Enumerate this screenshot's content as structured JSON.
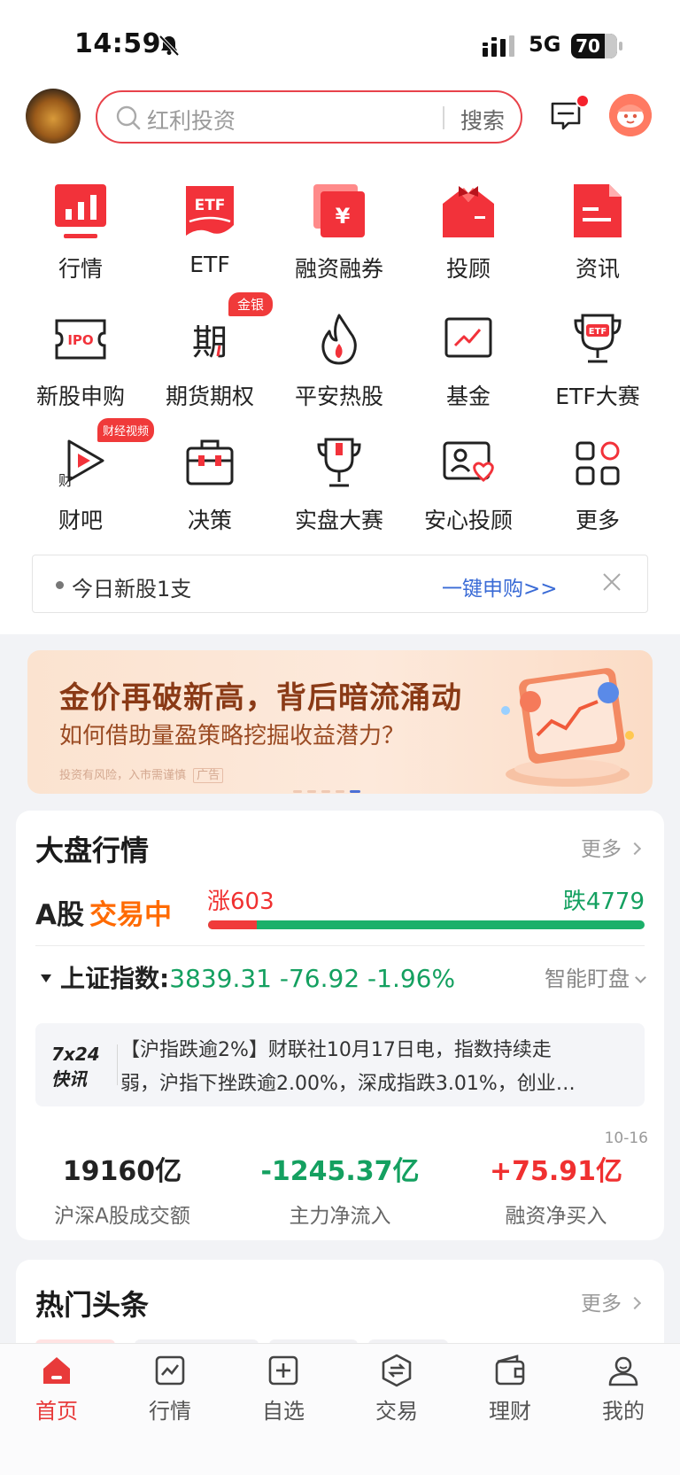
{
  "status_bar": {
    "time": "14:59",
    "network": "5G",
    "battery": "70"
  },
  "search": {
    "placeholder": "红利投资",
    "button": "搜索"
  },
  "grid": [
    {
      "label": "行情",
      "icon": "chart-bars-icon"
    },
    {
      "label": "ETF",
      "icon": "etf-icon"
    },
    {
      "label": "融资融券",
      "icon": "margin-trading-icon"
    },
    {
      "label": "投顾",
      "icon": "advisor-icon"
    },
    {
      "label": "资讯",
      "icon": "news-icon"
    },
    {
      "label": "新股申购",
      "icon": "ipo-icon"
    },
    {
      "label": "期货期权",
      "icon": "futures-icon",
      "badge": "金银"
    },
    {
      "label": "平安热股",
      "icon": "flame-icon"
    },
    {
      "label": "基金",
      "icon": "fund-icon"
    },
    {
      "label": "ETF大赛",
      "icon": "trophy-etf-icon"
    },
    {
      "label": "财吧",
      "icon": "caiba-play-icon",
      "badge": "财经视频"
    },
    {
      "label": "决策",
      "icon": "briefcase-icon"
    },
    {
      "label": "实盘大赛",
      "icon": "trophy-icon"
    },
    {
      "label": "安心投顾",
      "icon": "id-card-heart-icon"
    },
    {
      "label": "更多",
      "icon": "apps-grid-icon"
    }
  ],
  "notice": {
    "text": "今日新股1支",
    "action": "一键申购>>"
  },
  "banner": {
    "title": "金价再破新高，背后暗流涌动",
    "subtitle": "如何借助量盈策略挖掘收益潜力？",
    "disclaimer": "投资有风险，入市需谨慎",
    "ad_tag": "广告"
  },
  "market": {
    "title": "大盘行情",
    "more": "更多",
    "a_share": "A股",
    "trading_status": "交易中",
    "up_count": "涨603",
    "down_count": "跌4779",
    "up_ratio": 0.112,
    "index_label": "上证指数:",
    "index_value": "3839.31 -76.92 -1.96%",
    "smart_watch": "智能盯盘",
    "news_logo_line1": "7x24",
    "news_logo_line2": "快讯",
    "news_line1": "【沪指跌逾2%】财联社10月17日电，指数持续走",
    "news_line2": "弱，沪指下挫跌逾2.00%，深成指跌3.01%，创业…",
    "date": "10-16",
    "stats": [
      {
        "value": "19160亿",
        "label": "沪深A股成交额",
        "color": "#222222"
      },
      {
        "value": "-1245.37亿",
        "label": "主力净流入",
        "color": "#14a060"
      },
      {
        "value": "+75.91亿",
        "label": "融资净买入",
        "color": "#f03030"
      }
    ]
  },
  "headlines": {
    "title": "热门头条",
    "more": "更多"
  },
  "tabs": [
    {
      "label": "首页",
      "icon": "home-icon",
      "active": true
    },
    {
      "label": "行情",
      "icon": "market-chart-icon"
    },
    {
      "label": "自选",
      "icon": "add-watchlist-icon"
    },
    {
      "label": "交易",
      "icon": "trade-exchange-icon"
    },
    {
      "label": "理财",
      "icon": "wallet-icon"
    },
    {
      "label": "我的",
      "icon": "profile-icon"
    }
  ],
  "colors": {
    "brand_red": "#e8424a",
    "down_green": "#14a060",
    "up_red": "#f03030",
    "live_orange": "#ff6a00"
  }
}
